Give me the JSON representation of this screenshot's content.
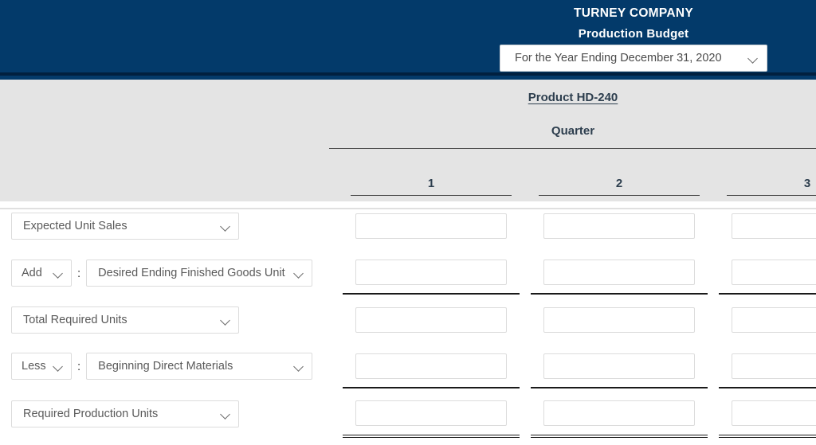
{
  "header": {
    "company": "TURNEY COMPANY",
    "title": "Production Budget",
    "period_selected": "For the Year Ending December 31, 2020",
    "period_icon": "chevron-down-icon"
  },
  "table_header": {
    "product": "Product HD-240",
    "group_label": "Quarter",
    "columns": [
      "1",
      "2",
      "3"
    ]
  },
  "rows": [
    {
      "id": "expected-unit-sales",
      "kind": "single",
      "label": "Expected Unit Sales",
      "rule": "none"
    },
    {
      "id": "desired-ending-finished-goods",
      "kind": "prefixed",
      "prefix": "Add",
      "separator": ":",
      "label": "Desired Ending Finished Goods Unit",
      "rule": "single"
    },
    {
      "id": "total-required-units",
      "kind": "single",
      "label": "Total Required Units",
      "rule": "none"
    },
    {
      "id": "beginning-direct-materials",
      "kind": "prefixed",
      "prefix": "Less",
      "separator": ":",
      "label": "Beginning Direct Materials",
      "rule": "single"
    },
    {
      "id": "required-production-units",
      "kind": "single",
      "label": "Required Production Units",
      "rule": "double"
    }
  ],
  "colors": {
    "header_navy": "#033a6a",
    "header_rule": "#01203f",
    "block_grey": "#e4e4e4",
    "heading_text": "#2d3e4e",
    "field_border": "#dcdcdc"
  }
}
